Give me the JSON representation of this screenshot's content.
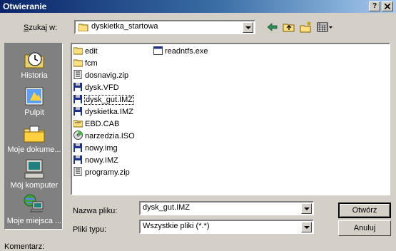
{
  "dialog": {
    "title": "Otwieranie",
    "help_button": "?",
    "close_button": "X"
  },
  "lookin": {
    "label": "Szukaj w:",
    "value": "dyskietka_startowa"
  },
  "toolbar": {
    "icons": [
      "back-icon",
      "up-folder-icon",
      "new-folder-icon",
      "view-menu-icon"
    ]
  },
  "places": [
    {
      "label": "Historia",
      "icon": "history-icon"
    },
    {
      "label": "Pulpit",
      "icon": "desktop-icon"
    },
    {
      "label": "Moje dokume...",
      "icon": "my-documents-icon"
    },
    {
      "label": "Mój komputer",
      "icon": "my-computer-icon"
    },
    {
      "label": "Moje miejsca ...",
      "icon": "network-places-icon"
    }
  ],
  "files": [
    {
      "name": "edit",
      "icon": "folder-icon"
    },
    {
      "name": "fcm",
      "icon": "folder-icon"
    },
    {
      "name": "dosnavig.zip",
      "icon": "zip-icon"
    },
    {
      "name": "dysk.VFD",
      "icon": "floppy-image-icon"
    },
    {
      "name": "dysk_gut.IMZ",
      "icon": "floppy-image-icon",
      "selected": true
    },
    {
      "name": "dyskietka.IMZ",
      "icon": "floppy-image-icon"
    },
    {
      "name": "EBD.CAB",
      "icon": "cab-icon"
    },
    {
      "name": "narzedzia.ISO",
      "icon": "cd-image-icon"
    },
    {
      "name": "nowy.img",
      "icon": "floppy-image-icon"
    },
    {
      "name": "nowy.IMZ",
      "icon": "floppy-image-icon"
    },
    {
      "name": "programy.zip",
      "icon": "zip-icon"
    },
    {
      "name": "readntfs.exe",
      "icon": "exe-icon"
    }
  ],
  "filename": {
    "label": "Nazwa pliku:",
    "value": "dysk_gut.IMZ"
  },
  "filetype": {
    "label": "Pliki typu:",
    "value": "Wszystkie pliki (*.*)"
  },
  "buttons": {
    "open": "Otwórz",
    "cancel": "Anuluj"
  },
  "comment": {
    "label": "Komentarz:"
  }
}
